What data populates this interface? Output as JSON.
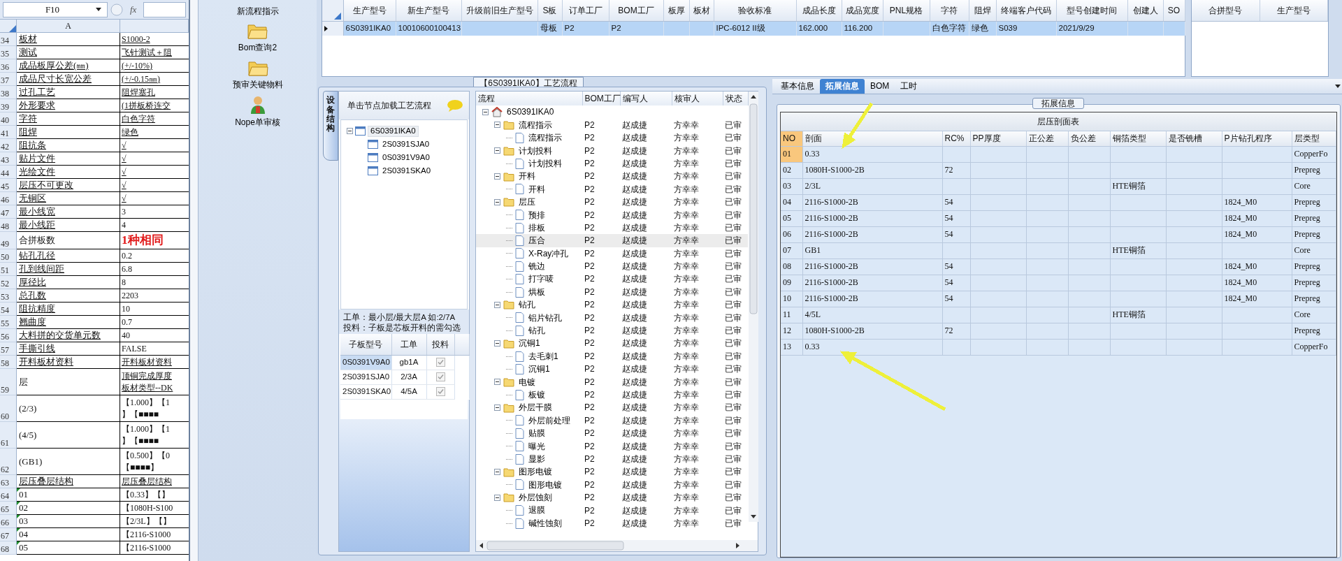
{
  "sheet": {
    "name_box": "F10",
    "formula_button": "fx",
    "column_a": "A",
    "rows": [
      {
        "n": "34",
        "a": "板材",
        "b": "S1000-2",
        "ua": true,
        "ub": true,
        "emph": false,
        "flag": false
      },
      {
        "n": "35",
        "a": "测试",
        "b": "飞针测试＋阻",
        "ua": true,
        "ub": true,
        "emph": false,
        "flag": false
      },
      {
        "n": "36",
        "a": "成品板厚公差(㎜)",
        "b": "(+/-10%)",
        "ua": true,
        "ub": true,
        "emph": false,
        "flag": false
      },
      {
        "n": "37",
        "a": "成品尺寸长宽公差",
        "b": "(+/-0.15㎜)",
        "ua": true,
        "ub": true,
        "emph": false,
        "flag": false
      },
      {
        "n": "38",
        "a": "过孔工艺",
        "b": "阻焊塞孔",
        "ua": true,
        "ub": true,
        "emph": false,
        "flag": false
      },
      {
        "n": "39",
        "a": "外形要求",
        "b": "(1拼板桥连交",
        "ua": true,
        "ub": true,
        "emph": false,
        "flag": false
      },
      {
        "n": "40",
        "a": "字符",
        "b": "白色字符",
        "ua": true,
        "ub": true,
        "emph": false,
        "flag": false
      },
      {
        "n": "41",
        "a": "阻焊",
        "b": "绿色",
        "ua": true,
        "ub": true,
        "emph": false,
        "flag": false
      },
      {
        "n": "42",
        "a": "阻抗条",
        "b": "√",
        "ua": true,
        "ub": true,
        "emph": false,
        "flag": false
      },
      {
        "n": "43",
        "a": "贴片文件",
        "b": "√",
        "ua": true,
        "ub": true,
        "emph": false,
        "flag": false
      },
      {
        "n": "44",
        "a": "光绘文件",
        "b": "√",
        "ua": true,
        "ub": true,
        "emph": false,
        "flag": false
      },
      {
        "n": "45",
        "a": "层压不可更改",
        "b": "√",
        "ua": true,
        "ub": true,
        "emph": false,
        "flag": false
      },
      {
        "n": "46",
        "a": "无铜区",
        "b": "√",
        "ua": true,
        "ub": true,
        "emph": false,
        "flag": false
      },
      {
        "n": "47",
        "a": "最小线宽",
        "b": "3",
        "ua": true,
        "ub": false,
        "emph": false,
        "flag": false
      },
      {
        "n": "48",
        "a": "最小线距",
        "b": "4",
        "ua": true,
        "ub": false,
        "emph": false,
        "flag": false
      },
      {
        "n": "49",
        "a": "合拼板数",
        "b": "1种相同",
        "ua": false,
        "ub": false,
        "emph": true,
        "flag": false
      },
      {
        "n": "50",
        "a": "钻孔孔径",
        "b": "0.2",
        "ua": true,
        "ub": false,
        "emph": false,
        "flag": false
      },
      {
        "n": "51",
        "a": "孔到线间距",
        "b": "6.8",
        "ua": true,
        "ub": false,
        "emph": false,
        "flag": false
      },
      {
        "n": "52",
        "a": "厚径比",
        "b": "8",
        "ua": true,
        "ub": false,
        "emph": false,
        "flag": false
      },
      {
        "n": "53",
        "a": "总孔数",
        "b": "2203",
        "ua": true,
        "ub": false,
        "emph": false,
        "flag": false
      },
      {
        "n": "54",
        "a": "阻抗精度",
        "b": "10",
        "ua": true,
        "ub": false,
        "emph": false,
        "flag": false
      },
      {
        "n": "55",
        "a": "翘曲度",
        "b": "0.7",
        "ua": true,
        "ub": false,
        "emph": false,
        "flag": false
      },
      {
        "n": "56",
        "a": "大料拼的交货单元数",
        "b": "40",
        "ua": true,
        "ub": false,
        "emph": false,
        "flag": false
      },
      {
        "n": "57",
        "a": "手撕引线",
        "b": "FALSE",
        "ua": true,
        "ub": false,
        "emph": false,
        "flag": false
      },
      {
        "n": "58",
        "a": "开料板材资料",
        "b": "开料板材资料",
        "ua": true,
        "ub": true,
        "emph": false,
        "flag": false
      },
      {
        "n": "59",
        "a": "层",
        "b": "顶铜完成厚度",
        "b2": "板材类型--DK",
        "ua": false,
        "ub": true,
        "emph": false,
        "flag": false
      },
      {
        "n": "60",
        "a": "(2/3)",
        "b": "【1.000】【1",
        "b2": "】【■■■■",
        "ua": false,
        "ub": false,
        "emph": false,
        "flag": false
      },
      {
        "n": "61",
        "a": "(4/5)",
        "b": "【1.000】【1",
        "b2": "】【■■■■",
        "ua": false,
        "ub": false,
        "emph": false,
        "flag": false
      },
      {
        "n": "62",
        "a": "(GB1)",
        "b": "【0.500】【0",
        "b2": "【■■■■】",
        "ua": false,
        "ub": false,
        "emph": false,
        "flag": false
      },
      {
        "n": "63",
        "a": "层压叠层结构",
        "b": "层压叠层结构",
        "ua": true,
        "ub": true,
        "emph": false,
        "flag": false
      },
      {
        "n": "64",
        "a": "01",
        "b": "【0.33】【】",
        "ua": false,
        "ub": false,
        "emph": false,
        "flag": true
      },
      {
        "n": "65",
        "a": "02",
        "b": "【1080H-S100",
        "ua": false,
        "ub": false,
        "emph": false,
        "flag": true
      },
      {
        "n": "66",
        "a": "03",
        "b": "【2/3L】【】",
        "ua": false,
        "ub": false,
        "emph": false,
        "flag": true
      },
      {
        "n": "67",
        "a": "04",
        "b": "【2116-S1000",
        "ua": false,
        "ub": false,
        "emph": false,
        "flag": true
      },
      {
        "n": "68",
        "a": "05",
        "b": "【2116-S1000",
        "ua": false,
        "ub": false,
        "emph": false,
        "flag": true
      }
    ]
  },
  "launcher": [
    {
      "label": "新流程指示",
      "kind": "plain"
    },
    {
      "label": "Bom查询2",
      "kind": "folder"
    },
    {
      "label": "预审关键物料",
      "kind": "folder"
    },
    {
      "label": "Nope单审核",
      "kind": "person"
    }
  ],
  "model_grid": {
    "columns": [
      "生产型号",
      "新生产型号",
      "升级前旧生产型号",
      "S板",
      "订单工厂",
      "BOM工厂",
      "板厚",
      "板材",
      "验收标准",
      "成品长度",
      "成品宽度",
      "PNL规格",
      "字符",
      "阻焊",
      "终端客户代码",
      "型号创建时间",
      "创建人",
      "SO"
    ],
    "rows": [
      {
        "selected": true,
        "cells": [
          "6S0391IKA0",
          "10010600100413",
          "",
          "母板",
          "P2",
          "P2",
          "",
          "",
          "IPC-6012 II级",
          "162.000",
          "116.200",
          "",
          "白色字符",
          "绿色",
          "S039",
          "2021/9/29",
          "",
          ""
        ]
      }
    ]
  },
  "merge_panel": {
    "columns": [
      "合拼型号",
      "生产型号"
    ]
  },
  "process_panel": {
    "title": "【6S0391IKA0】工艺流程",
    "side_tab": "设备结构",
    "hint": "单击节点加载工艺流程",
    "board_tree": {
      "label": "6S0391IKA0",
      "expanded": true,
      "selected": true,
      "children": [
        {
          "label": "2S0391SJA0",
          "selected": false
        },
        {
          "label": "0S0391V9A0",
          "selected": false
        },
        {
          "label": "2S0391SKA0",
          "selected": false
        }
      ]
    },
    "notes": [
      "工单：最小层/最大层A 如:2/7A",
      "投料：子板是芯板开料的需勾选"
    ],
    "sub_table": {
      "columns": [
        "子板型号",
        "工单",
        "投料"
      ],
      "rows": [
        {
          "board": "0S0391V9A0",
          "order": "gb1A",
          "fed": true,
          "selected": true
        },
        {
          "board": "2S0391SJA0",
          "order": "2/3A",
          "fed": true,
          "selected": false
        },
        {
          "board": "2S0391SKA0",
          "order": "4/5A",
          "fed": true,
          "selected": false
        }
      ]
    },
    "flow": {
      "columns": [
        "流程",
        "BOM工厂",
        "编写人",
        "核审人",
        "状态"
      ],
      "root": {
        "label": "6S0391IKA0",
        "expanded": true,
        "children": [
          {
            "label": "流程指示",
            "factory": "P2",
            "writer": "赵成捷",
            "reviewer": "方幸幸",
            "status": "已审",
            "selected": false,
            "expanded": true,
            "children": [
              {
                "label": "流程指示",
                "factory": "P2",
                "writer": "赵成捷",
                "reviewer": "方幸幸",
                "status": "已审",
                "selected": false
              }
            ]
          },
          {
            "label": "计划投料",
            "factory": "P2",
            "writer": "赵成捷",
            "reviewer": "方幸幸",
            "status": "已审",
            "selected": false,
            "expanded": true,
            "children": [
              {
                "label": "计划投料",
                "factory": "P2",
                "writer": "赵成捷",
                "reviewer": "方幸幸",
                "status": "已审",
                "selected": false
              }
            ]
          },
          {
            "label": "开料",
            "factory": "P2",
            "writer": "赵成捷",
            "reviewer": "方幸幸",
            "status": "已审",
            "selected": false,
            "expanded": true,
            "children": [
              {
                "label": "开料",
                "factory": "P2",
                "writer": "赵成捷",
                "reviewer": "方幸幸",
                "status": "已审",
                "selected": false
              }
            ]
          },
          {
            "label": "层压",
            "factory": "P2",
            "writer": "赵成捷",
            "reviewer": "方幸幸",
            "status": "已审",
            "selected": false,
            "expanded": true,
            "children": [
              {
                "label": "预排",
                "factory": "P2",
                "writer": "赵成捷",
                "reviewer": "方幸幸",
                "status": "已审",
                "selected": false
              },
              {
                "label": "排板",
                "factory": "P2",
                "writer": "赵成捷",
                "reviewer": "方幸幸",
                "status": "已审",
                "selected": false
              },
              {
                "label": "压合",
                "factory": "P2",
                "writer": "赵成捷",
                "reviewer": "方幸幸",
                "status": "已审",
                "selected": true
              },
              {
                "label": "X-Ray冲孔",
                "factory": "P2",
                "writer": "赵成捷",
                "reviewer": "方幸幸",
                "status": "已审",
                "selected": false
              },
              {
                "label": "铣边",
                "factory": "P2",
                "writer": "赵成捷",
                "reviewer": "方幸幸",
                "status": "已审",
                "selected": false
              },
              {
                "label": "打字唛",
                "factory": "P2",
                "writer": "赵成捷",
                "reviewer": "方幸幸",
                "status": "已审",
                "selected": false
              },
              {
                "label": "烘板",
                "factory": "P2",
                "writer": "赵成捷",
                "reviewer": "方幸幸",
                "status": "已审",
                "selected": false
              }
            ]
          },
          {
            "label": "钻孔",
            "factory": "P2",
            "writer": "赵成捷",
            "reviewer": "方幸幸",
            "status": "已审",
            "selected": false,
            "expanded": true,
            "children": [
              {
                "label": "铝片钻孔",
                "factory": "P2",
                "writer": "赵成捷",
                "reviewer": "方幸幸",
                "status": "已审",
                "selected": false
              },
              {
                "label": "钻孔",
                "factory": "P2",
                "writer": "赵成捷",
                "reviewer": "方幸幸",
                "status": "已审",
                "selected": false
              }
            ]
          },
          {
            "label": "沉铜1",
            "factory": "P2",
            "writer": "赵成捷",
            "reviewer": "方幸幸",
            "status": "已审",
            "selected": false,
            "expanded": true,
            "children": [
              {
                "label": "去毛刺1",
                "factory": "P2",
                "writer": "赵成捷",
                "reviewer": "方幸幸",
                "status": "已审",
                "selected": false
              },
              {
                "label": "沉铜1",
                "factory": "P2",
                "writer": "赵成捷",
                "reviewer": "方幸幸",
                "status": "已审",
                "selected": false
              }
            ]
          },
          {
            "label": "电镀",
            "factory": "P2",
            "writer": "赵成捷",
            "reviewer": "方幸幸",
            "status": "已审",
            "selected": false,
            "expanded": true,
            "children": [
              {
                "label": "板镀",
                "factory": "P2",
                "writer": "赵成捷",
                "reviewer": "方幸幸",
                "status": "已审",
                "selected": false
              }
            ]
          },
          {
            "label": "外层干膜",
            "factory": "P2",
            "writer": "赵成捷",
            "reviewer": "方幸幸",
            "status": "已审",
            "selected": false,
            "expanded": true,
            "children": [
              {
                "label": "外层前处理",
                "factory": "P2",
                "writer": "赵成捷",
                "reviewer": "方幸幸",
                "status": "已审",
                "selected": false
              },
              {
                "label": "贴膜",
                "factory": "P2",
                "writer": "赵成捷",
                "reviewer": "方幸幸",
                "status": "已审",
                "selected": false
              },
              {
                "label": "曝光",
                "factory": "P2",
                "writer": "赵成捷",
                "reviewer": "方幸幸",
                "status": "已审",
                "selected": false
              },
              {
                "label": "显影",
                "factory": "P2",
                "writer": "赵成捷",
                "reviewer": "方幸幸",
                "status": "已审",
                "selected": false
              }
            ]
          },
          {
            "label": "图形电镀",
            "factory": "P2",
            "writer": "赵成捷",
            "reviewer": "方幸幸",
            "status": "已审",
            "selected": false,
            "expanded": true,
            "children": [
              {
                "label": "图形电镀",
                "factory": "P2",
                "writer": "赵成捷",
                "reviewer": "方幸幸",
                "status": "已审",
                "selected": false
              }
            ]
          },
          {
            "label": "外层蚀刻",
            "factory": "P2",
            "writer": "赵成捷",
            "reviewer": "方幸幸",
            "status": "已审",
            "selected": false,
            "expanded": true,
            "children": [
              {
                "label": "退膜",
                "factory": "P2",
                "writer": "赵成捷",
                "reviewer": "方幸幸",
                "status": "已审",
                "selected": false
              },
              {
                "label": "碱性蚀刻",
                "factory": "P2",
                "writer": "赵成捷",
                "reviewer": "方幸幸",
                "status": "已审",
                "selected": false
              }
            ]
          }
        ]
      }
    }
  },
  "detail": {
    "tabs": [
      {
        "label": "基本信息",
        "selected": false
      },
      {
        "label": "拓展信息",
        "selected": true
      },
      {
        "label": "BOM",
        "selected": false
      },
      {
        "label": "工时",
        "selected": false
      }
    ],
    "group_title": "拓展信息",
    "table": {
      "title": "层压剖面表",
      "columns": [
        "NO",
        "剖面",
        "RC%",
        "PP厚度",
        "正公差",
        "负公差",
        "铜箔类型",
        "是否铣槽",
        "P片钻孔程序",
        "层类型"
      ],
      "rows": [
        {
          "selected": true,
          "cells": [
            "01",
            "0.33",
            "",
            "",
            "",
            "",
            "",
            "",
            "",
            "CopperFo"
          ]
        },
        {
          "selected": false,
          "cells": [
            "02",
            "1080H-S1000-2B",
            "72",
            "",
            "",
            "",
            "",
            "",
            "",
            "Prepreg"
          ]
        },
        {
          "selected": false,
          "cells": [
            "03",
            "2/3L",
            "",
            "",
            "",
            "",
            "HTE铜箔",
            "",
            "",
            "Core"
          ]
        },
        {
          "selected": false,
          "cells": [
            "04",
            "2116-S1000-2B",
            "54",
            "",
            "",
            "",
            "",
            "",
            "1824_M0",
            "Prepreg"
          ]
        },
        {
          "selected": false,
          "cells": [
            "05",
            "2116-S1000-2B",
            "54",
            "",
            "",
            "",
            "",
            "",
            "1824_M0",
            "Prepreg"
          ]
        },
        {
          "selected": false,
          "cells": [
            "06",
            "2116-S1000-2B",
            "54",
            "",
            "",
            "",
            "",
            "",
            "1824_M0",
            "Prepreg"
          ]
        },
        {
          "selected": false,
          "cells": [
            "07",
            "GB1",
            "",
            "",
            "",
            "",
            "HTE铜箔",
            "",
            "",
            "Core"
          ]
        },
        {
          "selected": false,
          "cells": [
            "08",
            "2116-S1000-2B",
            "54",
            "",
            "",
            "",
            "",
            "",
            "1824_M0",
            "Prepreg"
          ]
        },
        {
          "selected": false,
          "cells": [
            "09",
            "2116-S1000-2B",
            "54",
            "",
            "",
            "",
            "",
            "",
            "1824_M0",
            "Prepreg"
          ]
        },
        {
          "selected": false,
          "cells": [
            "10",
            "2116-S1000-2B",
            "54",
            "",
            "",
            "",
            "",
            "",
            "1824_M0",
            "Prepreg"
          ]
        },
        {
          "selected": false,
          "cells": [
            "11",
            "4/5L",
            "",
            "",
            "",
            "",
            "HTE铜箔",
            "",
            "",
            "Core"
          ]
        },
        {
          "selected": false,
          "cells": [
            "12",
            "1080H-S1000-2B",
            "72",
            "",
            "",
            "",
            "",
            "",
            "",
            "Prepreg"
          ]
        },
        {
          "selected": false,
          "cells": [
            "13",
            "0.33",
            "",
            "",
            "",
            "",
            "",
            "",
            "",
            "CopperFo"
          ]
        }
      ]
    }
  },
  "annotation_arrows": [
    {
      "color": "#eef03a"
    },
    {
      "color": "#eef03a"
    }
  ]
}
